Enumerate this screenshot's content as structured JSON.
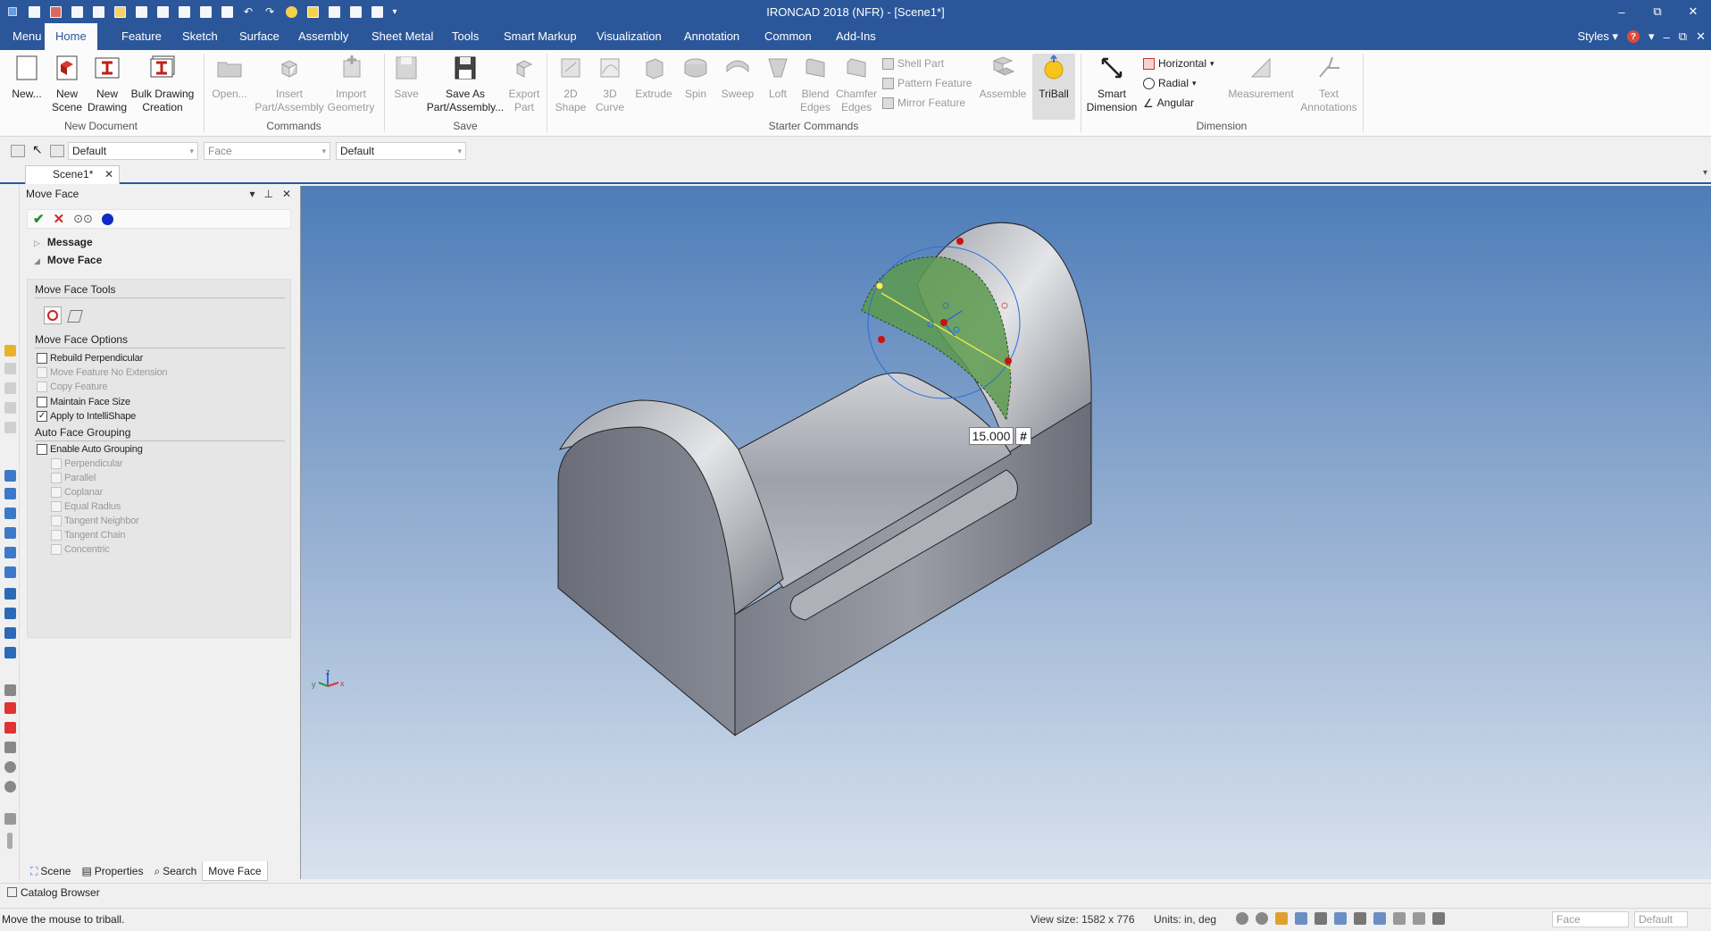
{
  "window": {
    "title": "IRONCAD 2018 (NFR) - [Scene1*]",
    "controls": {
      "minimize": "–",
      "restore": "⧉",
      "close": "✕"
    }
  },
  "tabs": [
    "Menu",
    "Home",
    "Feature",
    "Sketch",
    "Surface",
    "Assembly",
    "Sheet Metal",
    "Tools",
    "Smart Markup",
    "Visualization",
    "Annotation",
    "Common",
    "Add-Ins"
  ],
  "active_tab": "Home",
  "styles_label": "Styles",
  "ribbon": {
    "new_document": {
      "label": "New Document",
      "buttons": [
        {
          "line1": "New...",
          "line2": ""
        },
        {
          "line1": "New",
          "line2": "Scene"
        },
        {
          "line1": "New",
          "line2": "Drawing"
        },
        {
          "line1": "Bulk Drawing",
          "line2": "Creation"
        }
      ]
    },
    "commands": {
      "label": "Commands",
      "buttons": [
        {
          "line1": "Open...",
          "line2": ""
        },
        {
          "line1": "Insert",
          "line2": "Part/Assembly"
        },
        {
          "line1": "Import",
          "line2": "Geometry"
        }
      ]
    },
    "save": {
      "label": "Save",
      "buttons": [
        {
          "line1": "Save",
          "line2": ""
        },
        {
          "line1": "Save As",
          "line2": "Part/Assembly..."
        },
        {
          "line1": "Export",
          "line2": "Part"
        }
      ]
    },
    "starter": {
      "label": "Starter Commands",
      "buttons": [
        {
          "line1": "2D",
          "line2": "Shape"
        },
        {
          "line1": "3D",
          "line2": "Curve"
        },
        {
          "line1": "Extrude",
          "line2": ""
        },
        {
          "line1": "Spin",
          "line2": ""
        },
        {
          "line1": "Sweep",
          "line2": ""
        },
        {
          "line1": "Loft",
          "line2": ""
        },
        {
          "line1": "Blend",
          "line2": "Edges"
        },
        {
          "line1": "Chamfer",
          "line2": "Edges"
        }
      ],
      "small": [
        "Shell Part",
        "Pattern Feature",
        "Mirror Feature"
      ],
      "assemble": "Assemble",
      "triball": "TriBall"
    },
    "dimension": {
      "label": "Dimension",
      "smart_line1": "Smart",
      "smart_line2": "Dimension",
      "small": [
        "Horizontal",
        "Radial",
        "Angular"
      ]
    },
    "other": {
      "measurement": "Measurement",
      "text_line1": "Text",
      "text_line2": "Annotations"
    }
  },
  "toolbar": {
    "combo1": "Default",
    "combo2": "Face",
    "combo3": "Default"
  },
  "doc_tab": "Scene1*",
  "panel": {
    "title": "Move Face",
    "message_section": "Message",
    "move_face_section": "Move Face",
    "tools_header": "Move Face Tools",
    "options_header": "Move Face Options",
    "options": [
      {
        "label": "Rebuild Perpendicular",
        "checked": false,
        "enabled": true
      },
      {
        "label": "Move Feature No Extension",
        "checked": false,
        "enabled": false
      },
      {
        "label": "Copy Feature",
        "checked": false,
        "enabled": false
      },
      {
        "label": "Maintain Face Size",
        "checked": false,
        "enabled": true
      },
      {
        "label": "Apply to IntelliShape",
        "checked": true,
        "enabled": true
      }
    ],
    "grouping_header": "Auto Face Grouping",
    "enable_grouping": "Enable Auto Grouping",
    "grouping_options": [
      "Perpendicular",
      "Parallel",
      "Coplanar",
      "Equal Radius",
      "Tangent Neighbor",
      "Tangent Chain",
      "Concentric"
    ]
  },
  "bottom_tabs": [
    "Scene",
    "Properties",
    "Search",
    "Move Face"
  ],
  "viewport": {
    "dimension_value": "15.000",
    "dimension_suffix": "#",
    "axis_labels": {
      "x": "x",
      "y": "y",
      "z": "z"
    }
  },
  "catalog_browser": "Catalog Browser",
  "status": {
    "message": "Move the mouse to triball.",
    "view_size": "View size: 1582 x 776",
    "units": "Units: in, deg",
    "combo1": "Face",
    "combo2": "Default"
  },
  "colors": {
    "accent": "#2b579a",
    "selected_face": "#5c9a4e",
    "handle_red": "#cc1111",
    "handle_blue": "#2a6fd6"
  }
}
